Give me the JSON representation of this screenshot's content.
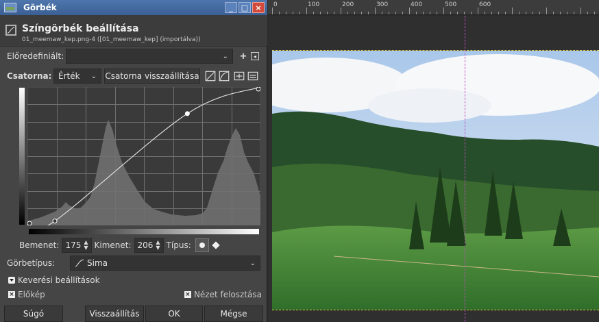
{
  "window": {
    "title": "Görbék",
    "controls": [
      "_",
      "□",
      "×"
    ]
  },
  "header": {
    "title": "Színgörbék beállítása",
    "subtitle": "01_meemaw_kep.png-4 ([01_meemaw_kep] (importálva))"
  },
  "presets": {
    "label": "Előredefiniált:",
    "value": "",
    "add": "+",
    "menu": "◂"
  },
  "channel": {
    "label": "Csatorna:",
    "value": "Érték",
    "reset_label": "Csatorna visszaállítása"
  },
  "curve": {
    "points": [
      [
        0,
        0
      ],
      [
        30,
        8
      ],
      [
        175,
        206
      ],
      [
        255,
        255
      ]
    ]
  },
  "io": {
    "input_label": "Bemenet:",
    "input_value": "175",
    "output_label": "Kimenet:",
    "output_value": "206",
    "type_label": "Típus:"
  },
  "curve_type": {
    "label": "Görbetípus:",
    "value": "Sima"
  },
  "blending": {
    "label": "Keverési beállítások"
  },
  "preview": {
    "label": "Előkép",
    "split_label": "Nézet felosztása"
  },
  "buttons": {
    "help": "Súgó",
    "reset": "Visszaállítás",
    "ok": "OK",
    "cancel": "Mégse"
  },
  "ruler": {
    "labels": [
      "0",
      "100",
      "200",
      "300",
      "400",
      "500",
      "600"
    ]
  },
  "colors": {
    "titlebar": "#4570a8",
    "close": "#d24b3a"
  }
}
